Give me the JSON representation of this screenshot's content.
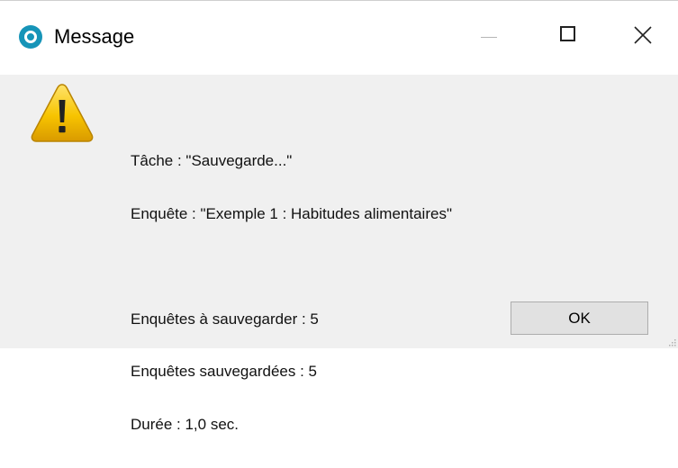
{
  "window": {
    "title": "Message",
    "app_icon": "app-logo-icon",
    "controls": {
      "minimize_icon": "minimize-icon",
      "maximize_icon": "maximize-icon",
      "close_icon": "close-icon"
    }
  },
  "dialog": {
    "icon": "warning-icon",
    "lines": {
      "task": "Tâche : \"Sauvegarde...\"",
      "survey": "Enquête : \"Exemple 1 : Habitudes alimentaires\"",
      "to_save": "Enquêtes à sauvegarder : 5",
      "saved": "Enquêtes sauvegardées : 5",
      "duration": "Durée : 1,0 sec."
    },
    "ok_label": "OK"
  },
  "colors": {
    "accent": "#1694b8",
    "warning": "#f5c400",
    "background": "#f0f0f0"
  }
}
